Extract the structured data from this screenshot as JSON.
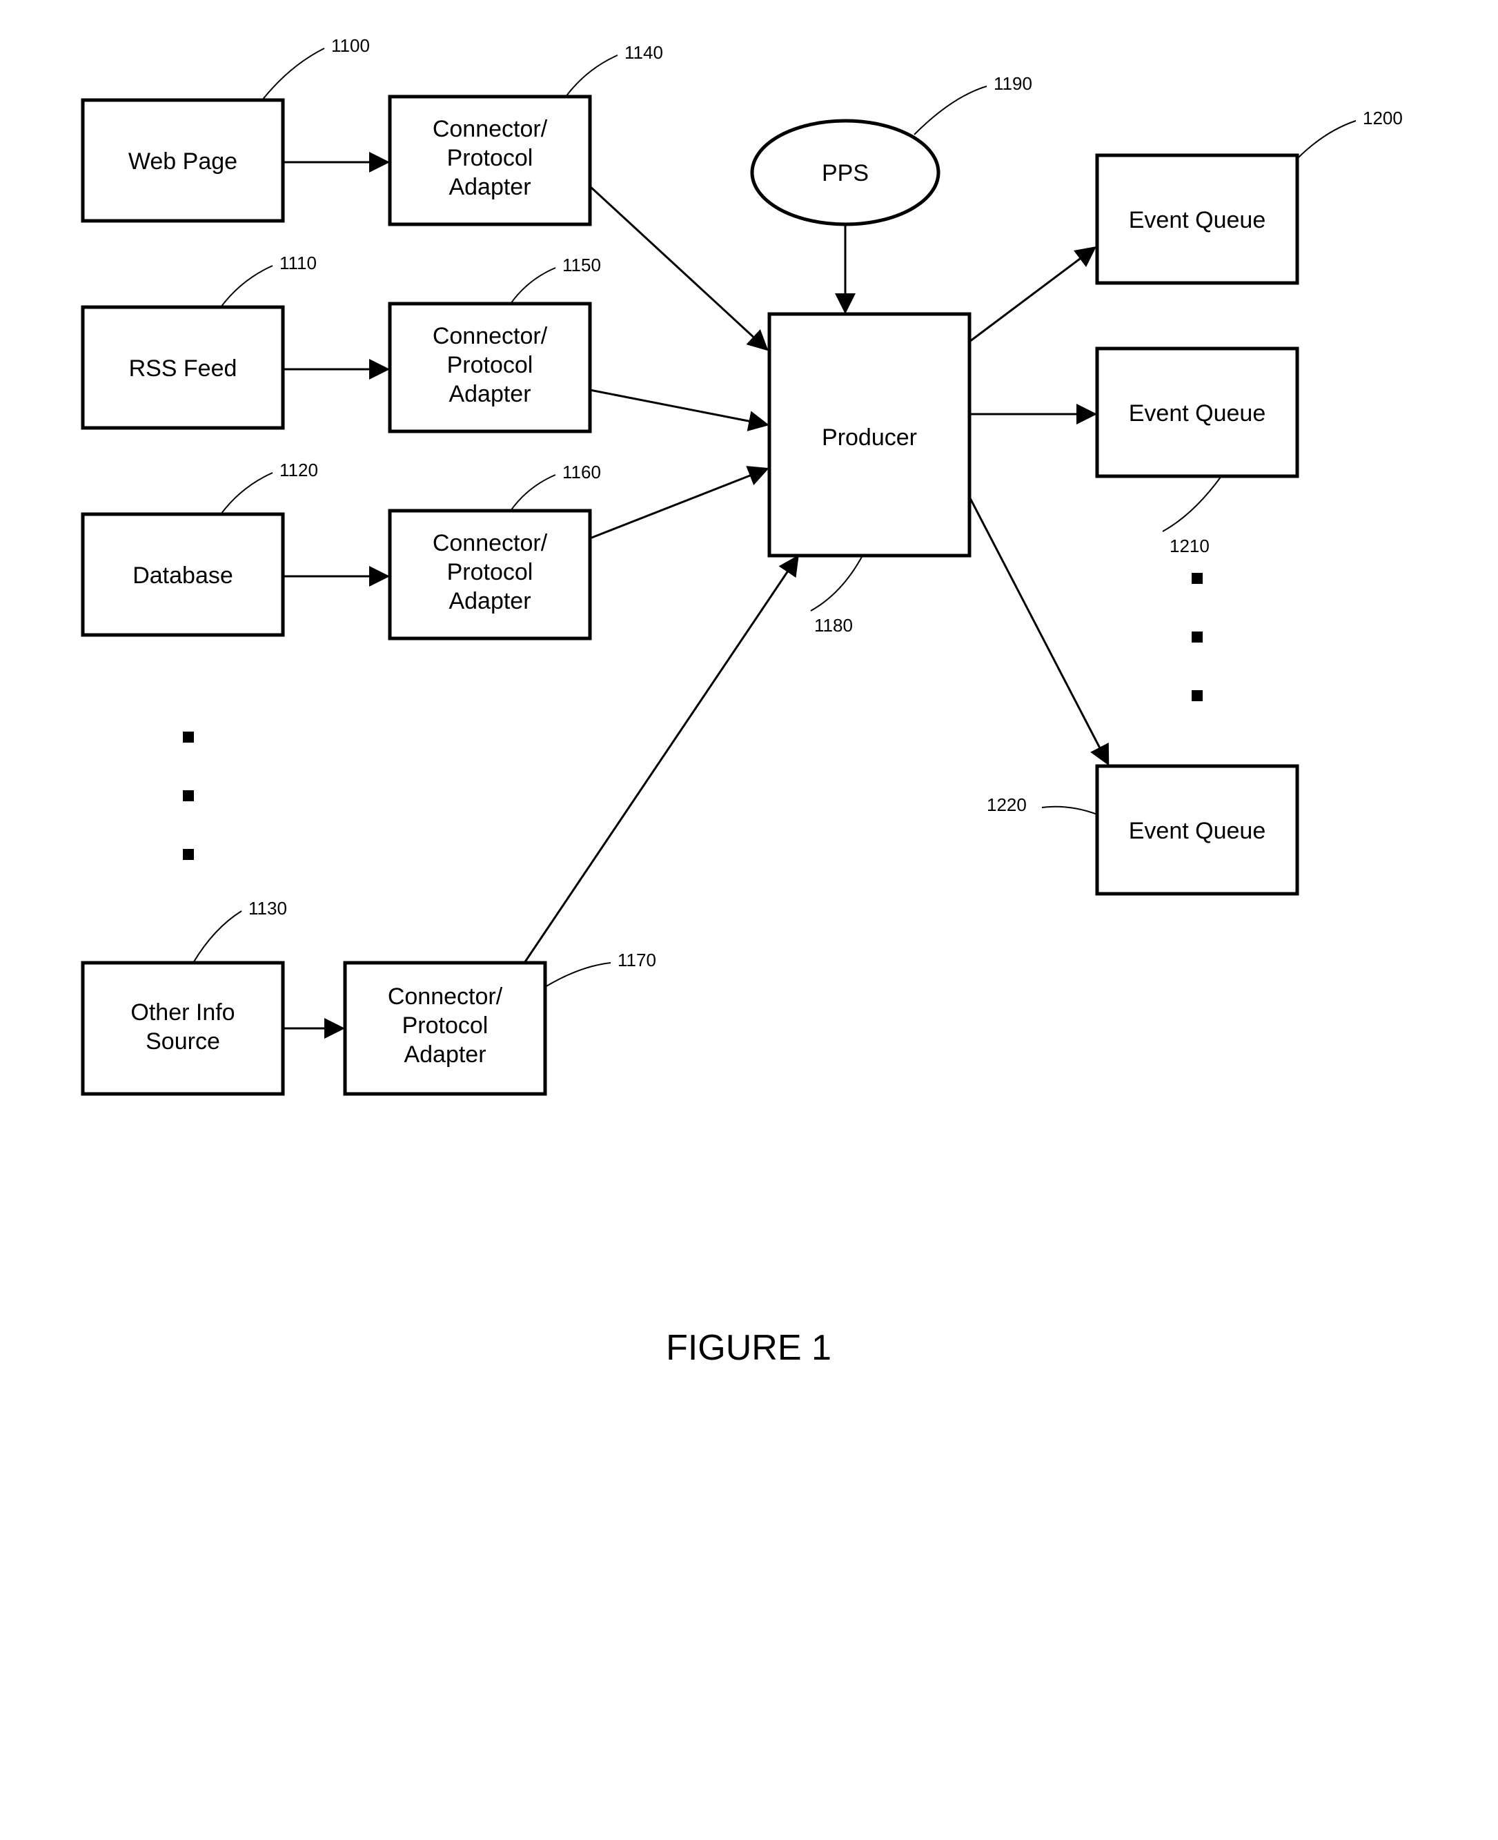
{
  "figure_label": "FIGURE 1",
  "nodes": {
    "web_page": {
      "text": "Web Page",
      "ref": "1100"
    },
    "rss_feed": {
      "text": "RSS Feed",
      "ref": "1110"
    },
    "database": {
      "text": "Database",
      "ref": "1120"
    },
    "other_src": {
      "text": "Other Info\nSource",
      "ref": "1130"
    },
    "conn1": {
      "text": "Connector/\nProtocol\nAdapter",
      "ref": "1140"
    },
    "conn2": {
      "text": "Connector/\nProtocol\nAdapter",
      "ref": "1150"
    },
    "conn3": {
      "text": "Connector/\nProtocol\nAdapter",
      "ref": "1160"
    },
    "conn4": {
      "text": "Connector/\nProtocol\nAdapter",
      "ref": "1170"
    },
    "producer": {
      "text": "Producer",
      "ref": "1180"
    },
    "pps": {
      "text": "PPS",
      "ref": "1190"
    },
    "eq1": {
      "text": "Event Queue",
      "ref": "1200"
    },
    "eq2": {
      "text": "Event Queue",
      "ref": "1210"
    },
    "eq3": {
      "text": "Event Queue",
      "ref": "1220"
    }
  }
}
